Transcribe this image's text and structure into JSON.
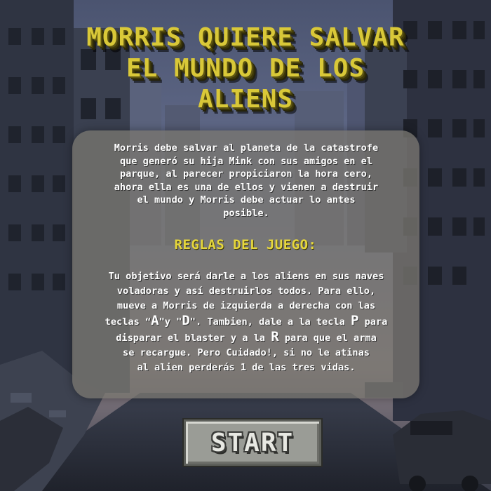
{
  "title": {
    "line1": "MORRIS QUIERE SALVAR",
    "line2": "EL MUNDO DE LOS",
    "line3": "ALIENS"
  },
  "story": {
    "line1": "Morris debe salvar al planeta de la catastrofe",
    "line2": "que generó su hija Mink con sus amigos en el",
    "line3": "parque, al parecer propiciaron la hora cero,",
    "line4": "ahora ella es una de ellos y vienen a destruir",
    "line5": "el mundo y Morris debe actuar lo antes",
    "line6": "posible."
  },
  "rules_heading": "REGLAS DEL JUEGO:",
  "rules": {
    "line1": "Tu objetivo será darle a los aliens en sus naves",
    "line2": "voladoras y así destruirlos todos. Para ello,",
    "line3": "mueve a Morris de izquierda a derecha con las",
    "line4_a": "teclas “",
    "key_left": "A",
    "line4_b": "\"y \"",
    "key_right": "D",
    "line4_c": "\". Tambien, dale a la  tecla ",
    "key_fire": "P",
    "line4_d": " para",
    "line5_a": "disparar el blaster y a la ",
    "key_reload": "R",
    "line5_b": " para que el arma",
    "line6": "se recargue. Pero Cuidado!, si no le atinas",
    "line7": "al alien perderás 1 de las tres vidas."
  },
  "start_label": "START",
  "colors": {
    "title": "#d9c838",
    "heading": "#e6d73c",
    "panel": "#78766f",
    "button": "#9a9c96",
    "sky": "#5f6a8c"
  },
  "icons": {
    "background": "post-apocalyptic-city-background"
  }
}
